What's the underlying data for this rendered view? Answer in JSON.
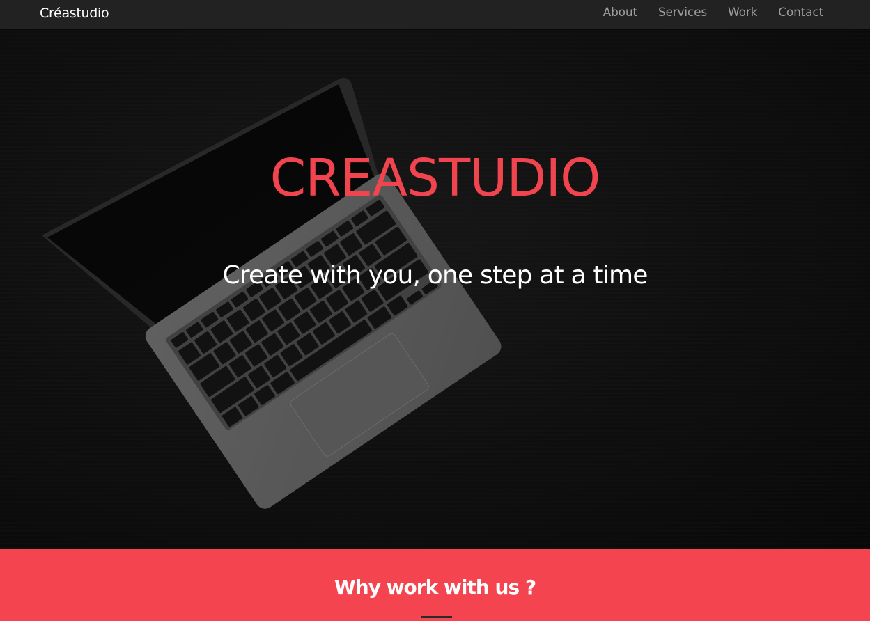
{
  "navbar": {
    "brand": "Créastudio",
    "links": [
      "About",
      "Services",
      "Work",
      "Contact"
    ]
  },
  "hero": {
    "title": "CREASTUDIO",
    "subtitle": "Create with you, one step at a time"
  },
  "why_section": {
    "title": "Why work with us ?"
  },
  "colors": {
    "accent": "#f4444f",
    "navbar_bg": "#222222",
    "nav_link": "#9d9d9d",
    "hero_title": "#f0444e"
  }
}
